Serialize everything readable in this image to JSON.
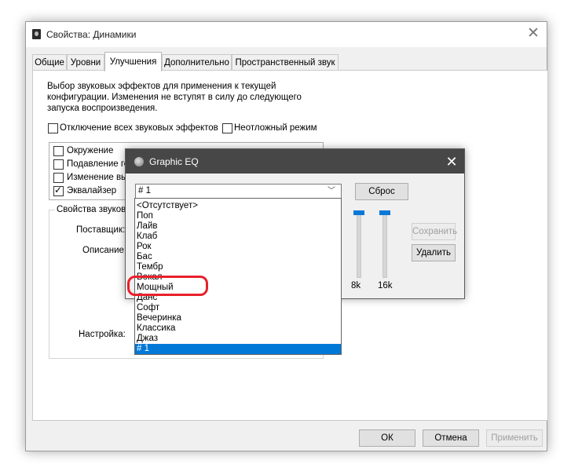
{
  "window": {
    "title": "Свойства: Динамики",
    "close_glyph": "✕"
  },
  "tabs": [
    {
      "label": "Общие"
    },
    {
      "label": "Уровни"
    },
    {
      "label": "Улучшения"
    },
    {
      "label": "Дополнительно"
    },
    {
      "label": "Пространственный звук"
    }
  ],
  "active_tab": "Улучшения",
  "enhancements": {
    "description": "Выбор звуковых эффектов для применения к текущей конфигурации. Изменения не вступят в силу до следующего запуска воспроизведения.",
    "disable_all_label": "Отключение всех звуковых эффектов",
    "immediate_mode_label": "Неотложный режим",
    "effects": [
      {
        "label": "Окружение",
        "checked": false
      },
      {
        "label": "Подавление го",
        "checked": false
      },
      {
        "label": "Изменение выс",
        "checked": false
      },
      {
        "label": "Эквалайзер",
        "checked": true
      }
    ],
    "properties_legend": "Свойства звуково",
    "provider_label": "Поставщик:",
    "description_label": "Описание:",
    "setting_label": "Настройка:"
  },
  "footer": {
    "ok": "ОК",
    "cancel": "Отмена",
    "apply": "Применить"
  },
  "graphic_eq": {
    "title": "Graphic EQ",
    "close_glyph": "✕",
    "preset_value": "# 1",
    "reset_button": "Сброс",
    "save_button": "Сохранить",
    "delete_button": "Удалить",
    "band_labels": [
      "8k",
      "16k"
    ],
    "presets": [
      "<Отсутствует>",
      "Поп",
      "Лайв",
      "Клаб",
      "Рок",
      "Бас",
      "Тембр",
      "Вокал",
      "Мощный",
      "Данс",
      "Софт",
      "Вечеринка",
      "Классика",
      "Джаз",
      "# 1"
    ],
    "selected_preset": "# 1",
    "highlighted_preset": "Мощный"
  },
  "colors": {
    "selection": "#0078d7",
    "highlight_ring": "#e8202a",
    "eq_titlebar": "#474747"
  }
}
